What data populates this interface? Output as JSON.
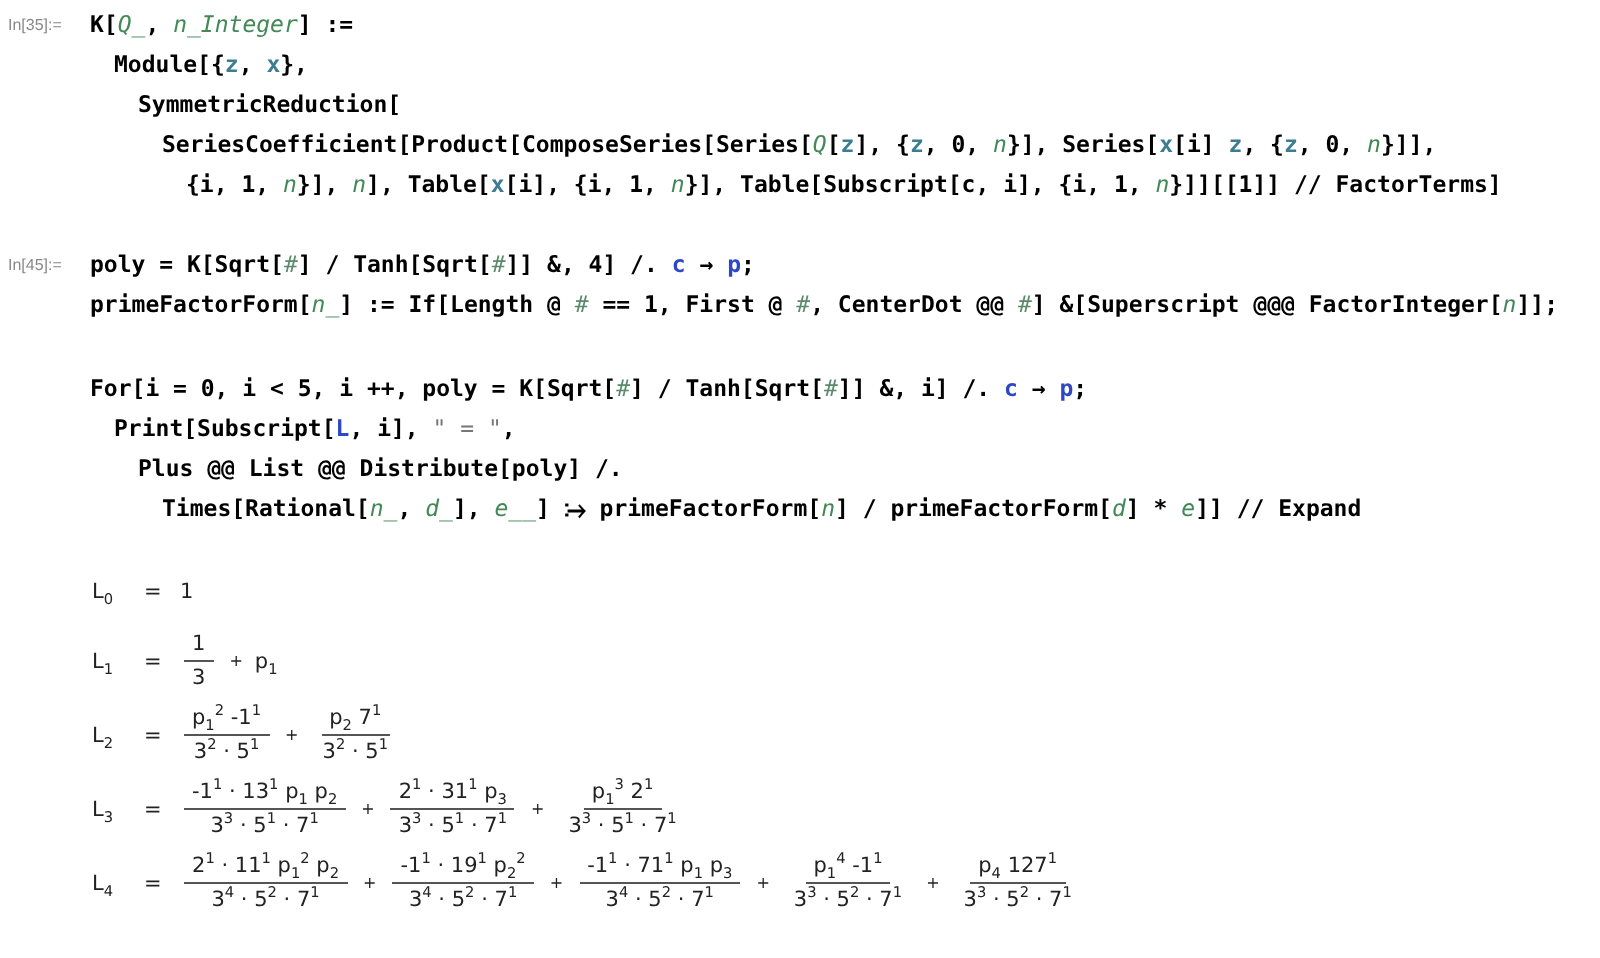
{
  "cells": [
    {
      "label": "In[35]:=",
      "groups": [
        [
          {
            "segments": [
              {
                "text": "K[",
                "kind": "plain"
              },
              {
                "text": "Q_",
                "kind": "pattern"
              },
              {
                "text": ", ",
                "kind": "plain"
              },
              {
                "text": "n_Integer",
                "kind": "pattern"
              },
              {
                "text": "] :=",
                "kind": "plain"
              }
            ],
            "children": [
              {
                "segments": [
                  {
                    "text": "Module[{",
                    "kind": "plain"
                  },
                  {
                    "text": "z",
                    "kind": "local"
                  },
                  {
                    "text": ", ",
                    "kind": "plain"
                  },
                  {
                    "text": "x",
                    "kind": "local"
                  },
                  {
                    "text": "},",
                    "kind": "plain"
                  }
                ],
                "children": [
                  {
                    "segments": [
                      {
                        "text": "SymmetricReduction[",
                        "kind": "plain"
                      }
                    ],
                    "children": [
                      {
                        "segments": [
                          {
                            "text": "SeriesCoefficient[Product[ComposeSeries[Series[",
                            "kind": "plain"
                          },
                          {
                            "text": "Q",
                            "kind": "pattern"
                          },
                          {
                            "text": "[",
                            "kind": "plain"
                          },
                          {
                            "text": "z",
                            "kind": "local"
                          },
                          {
                            "text": "], {",
                            "kind": "plain"
                          },
                          {
                            "text": "z",
                            "kind": "local"
                          },
                          {
                            "text": ", 0, ",
                            "kind": "plain"
                          },
                          {
                            "text": "n",
                            "kind": "pattern"
                          },
                          {
                            "text": "}], Series[",
                            "kind": "plain"
                          },
                          {
                            "text": "x",
                            "kind": "local"
                          },
                          {
                            "text": "[i] ",
                            "kind": "plain"
                          },
                          {
                            "text": "z",
                            "kind": "local"
                          },
                          {
                            "text": ", {",
                            "kind": "plain"
                          },
                          {
                            "text": "z",
                            "kind": "local"
                          },
                          {
                            "text": ", 0, ",
                            "kind": "plain"
                          },
                          {
                            "text": "n",
                            "kind": "pattern"
                          },
                          {
                            "text": "}]],",
                            "kind": "plain"
                          }
                        ],
                        "children": [
                          {
                            "segments": [
                              {
                                "text": "{i, 1, ",
                                "kind": "plain"
                              },
                              {
                                "text": "n",
                                "kind": "pattern"
                              },
                              {
                                "text": "}], ",
                                "kind": "plain"
                              },
                              {
                                "text": "n",
                                "kind": "pattern"
                              },
                              {
                                "text": "], Table[",
                                "kind": "plain"
                              },
                              {
                                "text": "x",
                                "kind": "local"
                              },
                              {
                                "text": "[i], {i, 1, ",
                                "kind": "plain"
                              },
                              {
                                "text": "n",
                                "kind": "pattern"
                              },
                              {
                                "text": "}], Table[Subscript[c, i], {i, 1, ",
                                "kind": "plain"
                              },
                              {
                                "text": "n",
                                "kind": "pattern"
                              },
                              {
                                "text": "}]][[1]] // FactorTerms]",
                                "kind": "plain"
                              }
                            ]
                          }
                        ]
                      }
                    ]
                  }
                ]
              }
            ]
          }
        ]
      ]
    },
    {
      "label": "In[45]:=",
      "groups": [
        [
          {
            "segments": [
              {
                "text": "poly = K[Sqrt[",
                "kind": "plain"
              },
              {
                "text": "#",
                "kind": "slot"
              },
              {
                "text": "] / Tanh[Sqrt[",
                "kind": "plain"
              },
              {
                "text": "#",
                "kind": "slot"
              },
              {
                "text": "]] &, 4] /. ",
                "kind": "plain"
              },
              {
                "text": "c",
                "kind": "global"
              },
              {
                "text": " → ",
                "kind": "plain"
              },
              {
                "text": "p",
                "kind": "global"
              },
              {
                "text": ";",
                "kind": "plain"
              }
            ]
          },
          {
            "segments": [
              {
                "text": "primeFactorForm[",
                "kind": "plain"
              },
              {
                "text": "n_",
                "kind": "pattern"
              },
              {
                "text": "] := If[Length @ ",
                "kind": "plain"
              },
              {
                "text": "#",
                "kind": "slot"
              },
              {
                "text": " == 1, First @ ",
                "kind": "plain"
              },
              {
                "text": "#",
                "kind": "slot"
              },
              {
                "text": ", CenterDot @@ ",
                "kind": "plain"
              },
              {
                "text": "#",
                "kind": "slot"
              },
              {
                "text": "] &[Superscript @@@ FactorInteger[",
                "kind": "plain"
              },
              {
                "text": "n",
                "kind": "pattern"
              },
              {
                "text": "]];",
                "kind": "plain"
              }
            ]
          }
        ],
        [
          {
            "segments": [
              {
                "text": "For[i = 0, i < 5, i ++, poly = K[Sqrt[",
                "kind": "plain"
              },
              {
                "text": "#",
                "kind": "slot"
              },
              {
                "text": "] / Tanh[Sqrt[",
                "kind": "plain"
              },
              {
                "text": "#",
                "kind": "slot"
              },
              {
                "text": "]] &, i] /. ",
                "kind": "plain"
              },
              {
                "text": "c",
                "kind": "global"
              },
              {
                "text": " → ",
                "kind": "plain"
              },
              {
                "text": "p",
                "kind": "global"
              },
              {
                "text": ";",
                "kind": "plain"
              }
            ],
            "children": [
              {
                "segments": [
                  {
                    "text": "Print[Subscript[",
                    "kind": "plain"
                  },
                  {
                    "text": "L",
                    "kind": "global"
                  },
                  {
                    "text": ", i], ",
                    "kind": "plain"
                  },
                  {
                    "text": "\" = \"",
                    "kind": "string"
                  },
                  {
                    "text": ",",
                    "kind": "plain"
                  }
                ],
                "children": [
                  {
                    "segments": [
                      {
                        "text": "Plus @@ List @@ Distribute[poly] /.",
                        "kind": "plain"
                      }
                    ],
                    "children": [
                      {
                        "segments": [
                          {
                            "text": "Times[Rational[",
                            "kind": "plain"
                          },
                          {
                            "text": "n_",
                            "kind": "pattern"
                          },
                          {
                            "text": ", ",
                            "kind": "plain"
                          },
                          {
                            "text": "d_",
                            "kind": "pattern"
                          },
                          {
                            "text": "], ",
                            "kind": "plain"
                          },
                          {
                            "text": "e__",
                            "kind": "pattern"
                          },
                          {
                            "text": "] ⧴ primeFactorForm[",
                            "kind": "plain"
                          },
                          {
                            "text": "n",
                            "kind": "pattern"
                          },
                          {
                            "text": "] / primeFactorForm[",
                            "kind": "plain"
                          },
                          {
                            "text": "d",
                            "kind": "pattern"
                          },
                          {
                            "text": "] * ",
                            "kind": "plain"
                          },
                          {
                            "text": "e",
                            "kind": "pattern"
                          },
                          {
                            "text": "]] // Expand",
                            "kind": "plain"
                          }
                        ]
                      }
                    ]
                  }
                ]
              }
            ]
          }
        ]
      ]
    }
  ],
  "outputs": [
    {
      "lhs": "L$_{0}$",
      "equals": "=",
      "terms": [
        {
          "kind": "text",
          "text": "1"
        }
      ]
    },
    {
      "lhs": "L$_{1}$",
      "equals": "=",
      "terms": [
        {
          "kind": "fraction",
          "numerator": "1",
          "denominator": "3"
        },
        {
          "kind": "operator",
          "text": "+"
        },
        {
          "kind": "text",
          "text": "p$_{1}$"
        }
      ]
    },
    {
      "lhs": "L$_{2}$",
      "equals": "=",
      "terms": [
        {
          "kind": "fraction",
          "numerator": "p$_{1}$$^{2}$ -1$^{1}$",
          "denominator": "3$^{2}$ · 5$^{1}$"
        },
        {
          "kind": "operator",
          "text": "+"
        },
        {
          "kind": "fraction",
          "numerator": "p$_{2}$ 7$^{1}$",
          "denominator": "3$^{2}$ · 5$^{1}$"
        }
      ]
    },
    {
      "lhs": "L$_{3}$",
      "equals": "=",
      "terms": [
        {
          "kind": "fraction",
          "numerator": "-1$^{1}$ · 13$^{1}$ p$_{1}$ p$_{2}$",
          "denominator": "3$^{3}$ · 5$^{1}$ · 7$^{1}$"
        },
        {
          "kind": "operator",
          "text": "+"
        },
        {
          "kind": "fraction",
          "numerator": "2$^{1}$ · 31$^{1}$ p$_{3}$",
          "denominator": "3$^{3}$ · 5$^{1}$ · 7$^{1}$"
        },
        {
          "kind": "operator",
          "text": "+"
        },
        {
          "kind": "fraction",
          "numerator": "p$_{1}$$^{3}$ 2$^{1}$",
          "denominator": "3$^{3}$ · 5$^{1}$ · 7$^{1}$"
        }
      ]
    },
    {
      "lhs": "L$_{4}$",
      "equals": "=",
      "terms": [
        {
          "kind": "fraction",
          "numerator": "2$^{1}$ · 11$^{1}$ p$_{1}$$^{2}$ p$_{2}$",
          "denominator": "3$^{4}$ · 5$^{2}$ · 7$^{1}$"
        },
        {
          "kind": "operator",
          "text": "+"
        },
        {
          "kind": "fraction",
          "numerator": "-1$^{1}$ · 19$^{1}$ p$_{2}$$^{2}$",
          "denominator": "3$^{4}$ · 5$^{2}$ · 7$^{1}$"
        },
        {
          "kind": "operator",
          "text": "+"
        },
        {
          "kind": "fraction",
          "numerator": "-1$^{1}$ · 71$^{1}$ p$_{1}$ p$_{3}$",
          "denominator": "3$^{4}$ · 5$^{2}$ · 7$^{1}$"
        },
        {
          "kind": "operator",
          "text": "+"
        },
        {
          "kind": "fraction",
          "numerator": "p$_{1}$$^{4}$ -1$^{1}$",
          "denominator": "3$^{3}$ · 5$^{2}$ · 7$^{1}$"
        },
        {
          "kind": "operator",
          "text": "+"
        },
        {
          "kind": "fraction",
          "numerator": "p$_{4}$ 127$^{1}$",
          "denominator": "3$^{3}$ · 5$^{2}$ · 7$^{1}$"
        }
      ]
    }
  ]
}
